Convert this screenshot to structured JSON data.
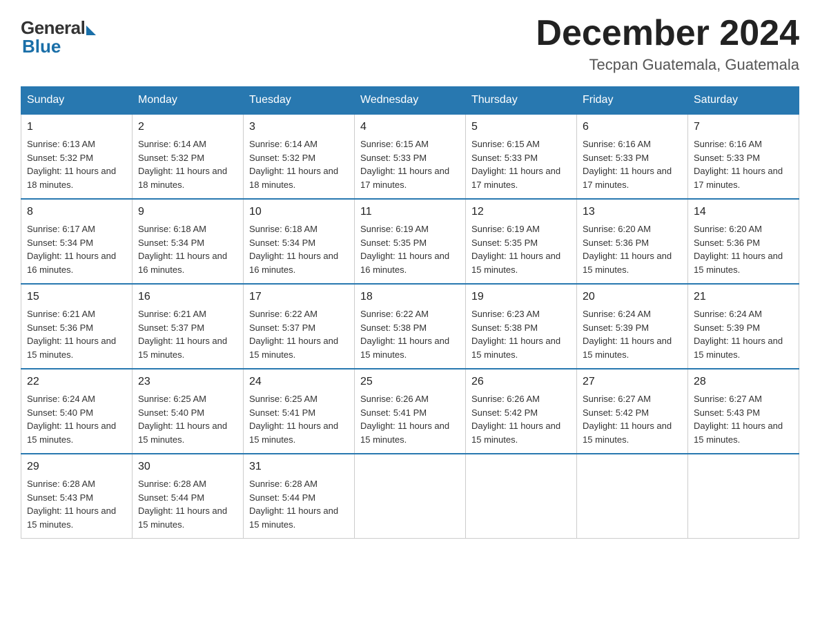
{
  "logo": {
    "general": "General",
    "blue": "Blue"
  },
  "title": "December 2024",
  "subtitle": "Tecpan Guatemala, Guatemala",
  "days": [
    "Sunday",
    "Monday",
    "Tuesday",
    "Wednesday",
    "Thursday",
    "Friday",
    "Saturday"
  ],
  "weeks": [
    [
      {
        "num": "1",
        "sunrise": "6:13 AM",
        "sunset": "5:32 PM",
        "daylight": "11 hours and 18 minutes."
      },
      {
        "num": "2",
        "sunrise": "6:14 AM",
        "sunset": "5:32 PM",
        "daylight": "11 hours and 18 minutes."
      },
      {
        "num": "3",
        "sunrise": "6:14 AM",
        "sunset": "5:32 PM",
        "daylight": "11 hours and 18 minutes."
      },
      {
        "num": "4",
        "sunrise": "6:15 AM",
        "sunset": "5:33 PM",
        "daylight": "11 hours and 17 minutes."
      },
      {
        "num": "5",
        "sunrise": "6:15 AM",
        "sunset": "5:33 PM",
        "daylight": "11 hours and 17 minutes."
      },
      {
        "num": "6",
        "sunrise": "6:16 AM",
        "sunset": "5:33 PM",
        "daylight": "11 hours and 17 minutes."
      },
      {
        "num": "7",
        "sunrise": "6:16 AM",
        "sunset": "5:33 PM",
        "daylight": "11 hours and 17 minutes."
      }
    ],
    [
      {
        "num": "8",
        "sunrise": "6:17 AM",
        "sunset": "5:34 PM",
        "daylight": "11 hours and 16 minutes."
      },
      {
        "num": "9",
        "sunrise": "6:18 AM",
        "sunset": "5:34 PM",
        "daylight": "11 hours and 16 minutes."
      },
      {
        "num": "10",
        "sunrise": "6:18 AM",
        "sunset": "5:34 PM",
        "daylight": "11 hours and 16 minutes."
      },
      {
        "num": "11",
        "sunrise": "6:19 AM",
        "sunset": "5:35 PM",
        "daylight": "11 hours and 16 minutes."
      },
      {
        "num": "12",
        "sunrise": "6:19 AM",
        "sunset": "5:35 PM",
        "daylight": "11 hours and 15 minutes."
      },
      {
        "num": "13",
        "sunrise": "6:20 AM",
        "sunset": "5:36 PM",
        "daylight": "11 hours and 15 minutes."
      },
      {
        "num": "14",
        "sunrise": "6:20 AM",
        "sunset": "5:36 PM",
        "daylight": "11 hours and 15 minutes."
      }
    ],
    [
      {
        "num": "15",
        "sunrise": "6:21 AM",
        "sunset": "5:36 PM",
        "daylight": "11 hours and 15 minutes."
      },
      {
        "num": "16",
        "sunrise": "6:21 AM",
        "sunset": "5:37 PM",
        "daylight": "11 hours and 15 minutes."
      },
      {
        "num": "17",
        "sunrise": "6:22 AM",
        "sunset": "5:37 PM",
        "daylight": "11 hours and 15 minutes."
      },
      {
        "num": "18",
        "sunrise": "6:22 AM",
        "sunset": "5:38 PM",
        "daylight": "11 hours and 15 minutes."
      },
      {
        "num": "19",
        "sunrise": "6:23 AM",
        "sunset": "5:38 PM",
        "daylight": "11 hours and 15 minutes."
      },
      {
        "num": "20",
        "sunrise": "6:24 AM",
        "sunset": "5:39 PM",
        "daylight": "11 hours and 15 minutes."
      },
      {
        "num": "21",
        "sunrise": "6:24 AM",
        "sunset": "5:39 PM",
        "daylight": "11 hours and 15 minutes."
      }
    ],
    [
      {
        "num": "22",
        "sunrise": "6:24 AM",
        "sunset": "5:40 PM",
        "daylight": "11 hours and 15 minutes."
      },
      {
        "num": "23",
        "sunrise": "6:25 AM",
        "sunset": "5:40 PM",
        "daylight": "11 hours and 15 minutes."
      },
      {
        "num": "24",
        "sunrise": "6:25 AM",
        "sunset": "5:41 PM",
        "daylight": "11 hours and 15 minutes."
      },
      {
        "num": "25",
        "sunrise": "6:26 AM",
        "sunset": "5:41 PM",
        "daylight": "11 hours and 15 minutes."
      },
      {
        "num": "26",
        "sunrise": "6:26 AM",
        "sunset": "5:42 PM",
        "daylight": "11 hours and 15 minutes."
      },
      {
        "num": "27",
        "sunrise": "6:27 AM",
        "sunset": "5:42 PM",
        "daylight": "11 hours and 15 minutes."
      },
      {
        "num": "28",
        "sunrise": "6:27 AM",
        "sunset": "5:43 PM",
        "daylight": "11 hours and 15 minutes."
      }
    ],
    [
      {
        "num": "29",
        "sunrise": "6:28 AM",
        "sunset": "5:43 PM",
        "daylight": "11 hours and 15 minutes."
      },
      {
        "num": "30",
        "sunrise": "6:28 AM",
        "sunset": "5:44 PM",
        "daylight": "11 hours and 15 minutes."
      },
      {
        "num": "31",
        "sunrise": "6:28 AM",
        "sunset": "5:44 PM",
        "daylight": "11 hours and 15 minutes."
      },
      null,
      null,
      null,
      null
    ]
  ]
}
